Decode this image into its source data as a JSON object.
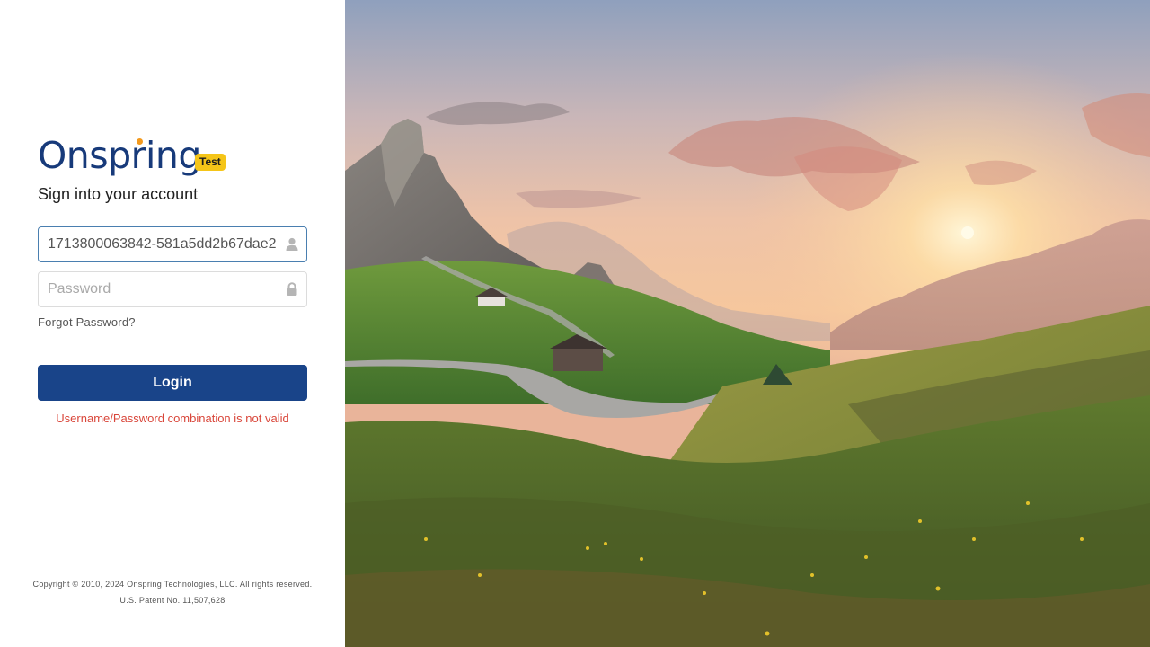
{
  "brand": {
    "logo_text": "Onspring",
    "env_badge": "Test"
  },
  "login": {
    "subtitle": "Sign into your account",
    "username_value": "1713800063842-581a5dd2b67dae2",
    "username_icon": "user-icon",
    "password_placeholder": "Password",
    "password_icon": "lock-icon",
    "forgot_label": "Forgot Password?",
    "login_label": "Login",
    "error_text": "Username/Password combination is not valid"
  },
  "footer": {
    "copyright": "Copyright © 2010, 2024 Onspring Technologies, LLC. All rights reserved.",
    "patent": "U.S. Patent No. 11,507,628"
  },
  "colors": {
    "brand_navy": "#173a7a",
    "logo_accent": "#f39a1e",
    "badge_yellow": "#f5c518",
    "login_button": "#194489",
    "error_red": "#d9463a",
    "focus_border": "#4a7fb0"
  }
}
